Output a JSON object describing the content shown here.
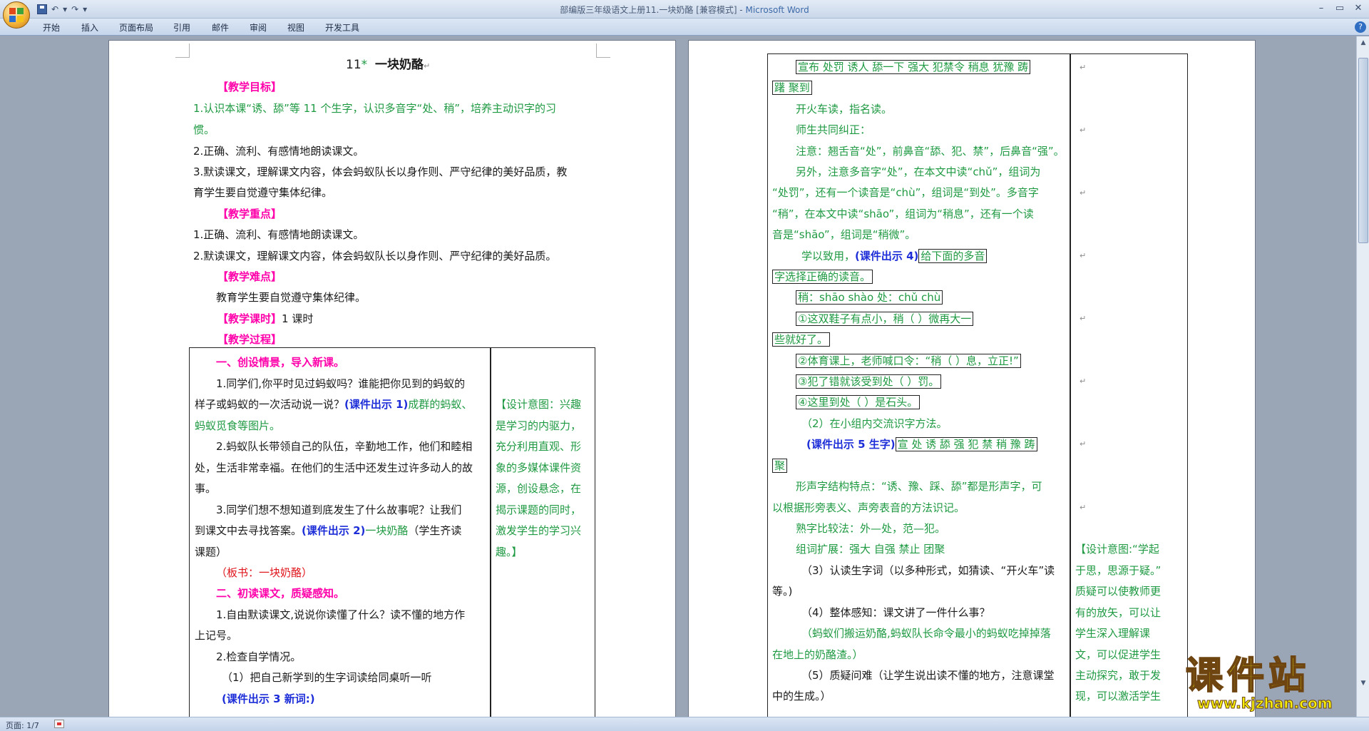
{
  "titlebar": {
    "doc_title": "部编版三年级语文上册11.一块奶酪 [兼容模式] - ",
    "app_name": "Microsoft Word",
    "minimize": "–",
    "restore": "▭",
    "close": "✕"
  },
  "qat": {
    "save_icon": "save-icon",
    "undo": "↶",
    "redo": "↷",
    "customize": "▾"
  },
  "ribbon": {
    "tabs": [
      "开始",
      "插入",
      "页面布局",
      "引用",
      "邮件",
      "审阅",
      "视图",
      "开发工具"
    ],
    "help": "?"
  },
  "statusbar": {
    "page": "页面: 1/7"
  },
  "watermark": {
    "main": "课件站",
    "url": "www.kjzhan.com"
  },
  "page1": {
    "title_num": "11",
    "title_star": "*",
    "title_text": "一块奶酪",
    "goal_head": "【教学目标】",
    "goal1a": "1.认识本课“诱、舔”等 11 个生字，认识多音字“处、稍”，培养主动识字的习",
    "goal1b": "惯。",
    "goal2": "2.正确、流利、有感情地朗读课文。",
    "goal3a": "3.默读课文，理解课文内容，体会蚂蚁队长以身作则、严守纪律的美好品质，教",
    "goal3b": "育学生要自觉遵守集体纪律。",
    "key_head": "【教学重点】",
    "key1": "1.正确、流利、有感情地朗读课文。",
    "key2": "2.默读课文，理解课文内容，体会蚂蚁队长以身作则、严守纪律的美好品质。",
    "diff_head": "【教学难点】",
    "diff1": "教育学生要自觉遵守集体纪律。",
    "time_head": "【教学课时】",
    "time_val": "1 课时",
    "proc_head": "【教学过程】",
    "t_l1": "一、创设情景，导入新课。",
    "t_l2": "1.同学们,你平时见过蚂蚁吗？谁能把你见到的蚂蚁的",
    "t_l3a": "样子或蚂蚁的一次活动说一说？",
    "t_l3b": "(课件出示 1)",
    "t_l3c": "成群的蚂蚁、",
    "t_l4": "蚂蚁觅食等图片。",
    "t_l5": "2.蚂蚁队长带领自己的队伍，辛勤地工作，他们和睦相",
    "t_l6": "处，生活非常幸福。在他们的生活中还发生过许多动人的故",
    "t_l7": "事。",
    "t_l8": "3.同学们想不想知道到底发生了什么故事呢？让我们",
    "t_l9a": "到课文中去寻找答案。",
    "t_l9b": "(课件出示 2)",
    "t_l9c": "一块奶酪",
    "t_l9d": "（学生齐读",
    "t_l10": "课题）",
    "t_l11": "（板书：一块奶酪）",
    "t_l12": "二、初读课文，质疑感知。",
    "t_l13": "1.自由默读课文,说说你读懂了什么？读不懂的地方作",
    "t_l14": "上记号。",
    "t_l15": "2.检查自学情况。",
    "t_l16": "（1）把自己新学到的生字词读给同桌听一听",
    "t_l17": "(课件出示 3 新词:)",
    "r1": "【设计意图：兴趣",
    "r2": "是学习的内驱力，",
    "r3": "充分利用直观、形",
    "r4": "象的多媒体课件资",
    "r5": "源，创设悬念，在",
    "r6": "揭示课题的同时，",
    "r7": "激发学生的学习兴",
    "r8": "趣。】"
  },
  "page2": {
    "l1": "宣布 处罚 诱人 舔一下 强大 犯禁令 稍息 犹豫 踌",
    "l2": "躇 聚到",
    "l3": "开火车读，指名读。",
    "l4": "师生共同纠正：",
    "l5": "注意：翘舌音“处”，前鼻音“舔、犯、禁”，后鼻音“强”。",
    "l6": "另外，注意多音字“处”，在本文中读“chǔ”，组词为",
    "l7": "“处罚”，还有一个读音是“chù”，组词是“到处”。多音字",
    "l8": "“稍”，在本文中读“shāo”，组词为“稍息”，还有一个读",
    "l9": "音是“shāo”，组词是“稍微”。",
    "l10a": "学以致用，",
    "l10b": "(课件出示 4)",
    "l10c": "给下面的多音",
    "l11": "字选择正确的读音。",
    "l12": "稍：shāo shào    处：chǔ chù",
    "l13": "①这双鞋子有点小，稍（       ）微再大一",
    "l14": "些就好了。",
    "l15": "②体育课上，老师喊口令：“稍（       ）息，立正!”",
    "l16": "③犯了错就该受到处（       ）罚。",
    "l17": "④这里到处（       ）是石头。",
    "l18": "（2）在小组内交流识字方法。",
    "l19a": "(课件出示 5 生字)",
    "l19b": "宣 处 诱 舔 强 犯 禁 稍 豫 踌",
    "l20": "聚",
    "l21": "形声字结构特点：“诱、豫、踩、舔”都是形声字，可",
    "l22": "以根据形旁表义、声旁表音的方法识记。",
    "l23": "熟字比较法：外—处，范—犯。",
    "l24": "组词扩展：强大 自强 禁止 团聚",
    "l25": "（3）认读生字词（以多种形式，如猜读、“开火车”读",
    "l26": "等。)",
    "l27": "（4）整体感知：课文讲了一件什么事？",
    "l28": "（蚂蚁们搬运奶酪,蚂蚁队长命令最小的蚂蚁吃掉掉落",
    "l29": "在地上的奶酪渣。）",
    "l30": "（5）质疑问难（让学生说出读不懂的地方，注意课堂",
    "l31": "中的生成。）",
    "r1": "【设计意图:“学起",
    "r2": "于思，思源于疑。”",
    "r3": "质疑可以使教师更",
    "r4": "有的放矢，可以让",
    "r5": "学生深入理解课",
    "r6": "文，可以促进学生",
    "r7": "主动探究，敢于发",
    "r8": "现，可以激活学生"
  },
  "pm": "↵",
  "colors": {
    "green": "#1f9a43",
    "magenta": "#ff00aa",
    "blue": "#1d2ed8",
    "red": "#e0141b"
  }
}
